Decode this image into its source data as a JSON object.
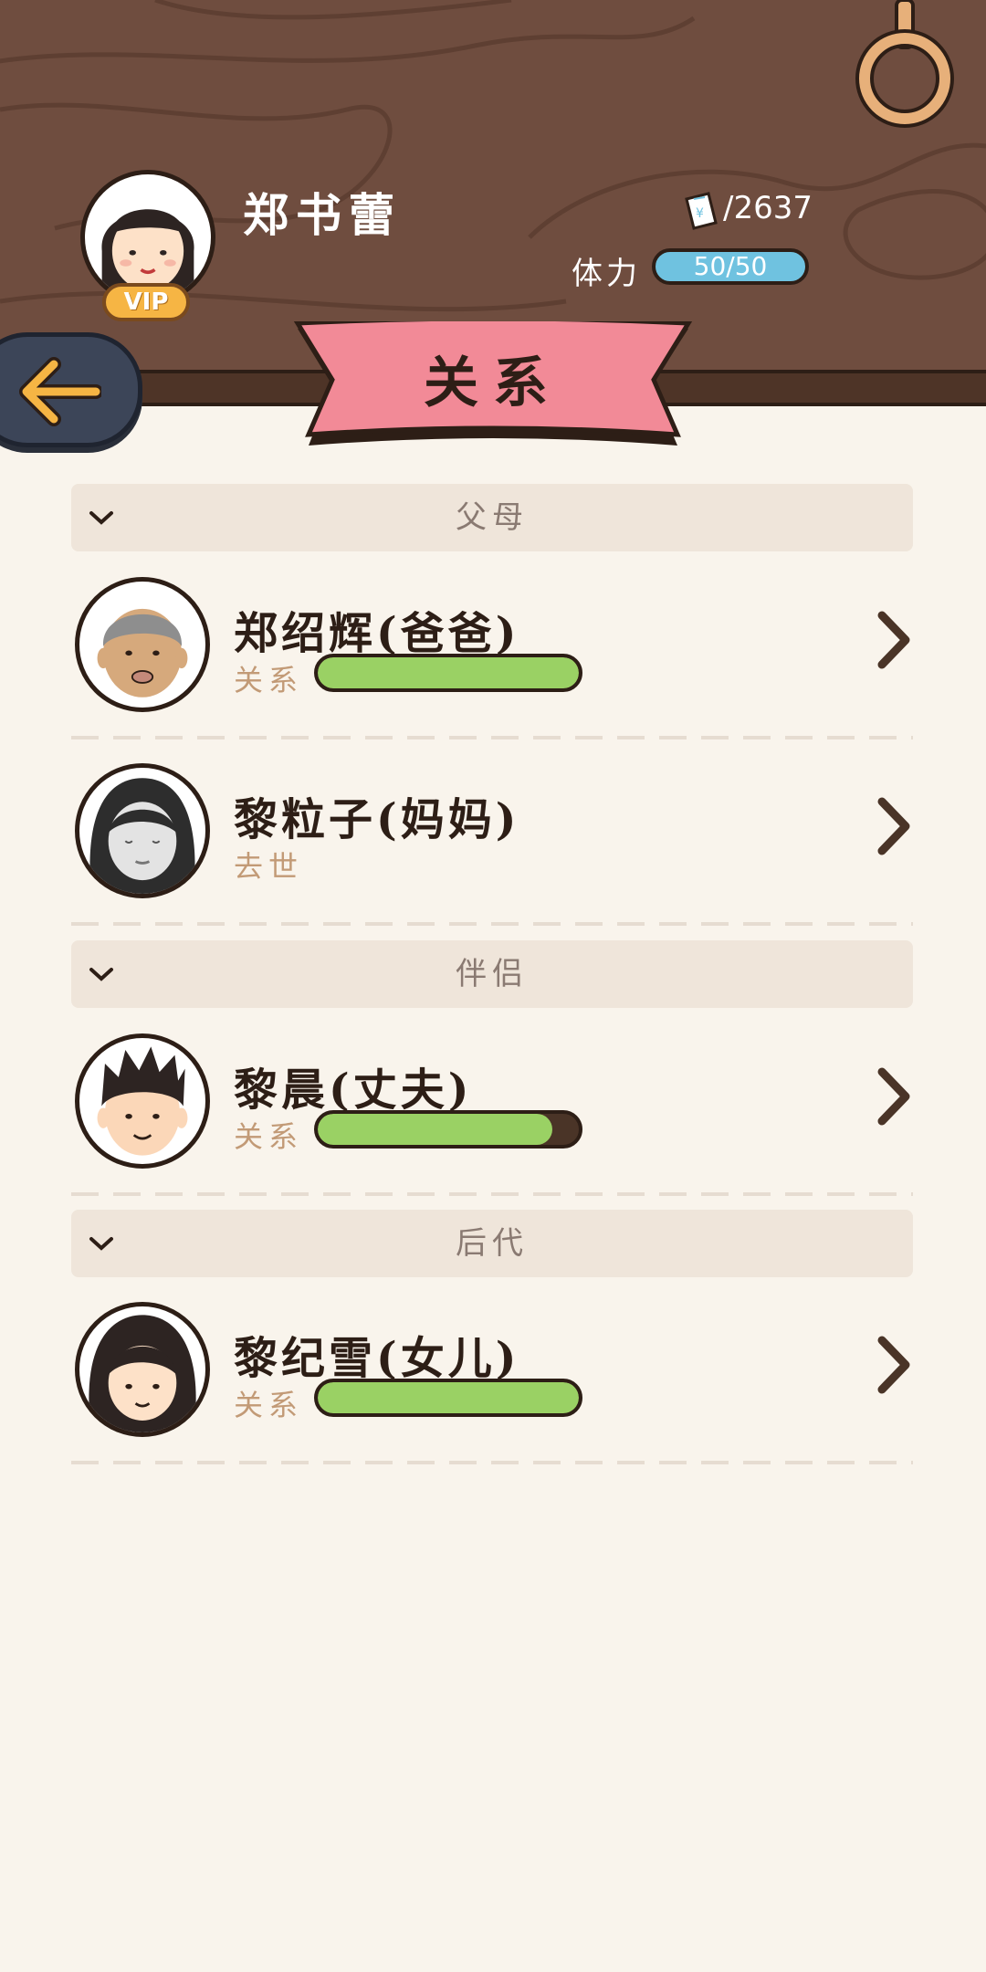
{
  "player": {
    "name": "郑书蕾",
    "vip_label": "VIP",
    "money": "/2637",
    "stamina_label": "体力",
    "stamina_value": "50/50",
    "stamina_fraction": 1.0
  },
  "page_title": "关系",
  "sections": [
    {
      "title": "父母",
      "rows": [
        {
          "name": "郑绍辉(爸爸)",
          "label": "关系",
          "relationship": 1.0,
          "avatar": "old-man-avatar"
        },
        {
          "name": "黎粒子(妈妈)",
          "label": "去世",
          "relationship": null,
          "avatar": "deceased-woman-avatar"
        }
      ]
    },
    {
      "title": "伴侣",
      "rows": [
        {
          "name": "黎晨(丈夫)",
          "label": "关系",
          "relationship": 0.9,
          "avatar": "man-avatar"
        }
      ]
    },
    {
      "title": "后代",
      "rows": [
        {
          "name": "黎纪雪(女儿)",
          "label": "关系",
          "relationship": 1.0,
          "avatar": "girl-avatar"
        }
      ]
    }
  ],
  "colors": {
    "wood": "#6f4d3f",
    "ribbon": "#f28a97",
    "bar_fill": "#9ad164",
    "stamina_bar": "#6fc2e0",
    "background": "#f9f4ec"
  }
}
